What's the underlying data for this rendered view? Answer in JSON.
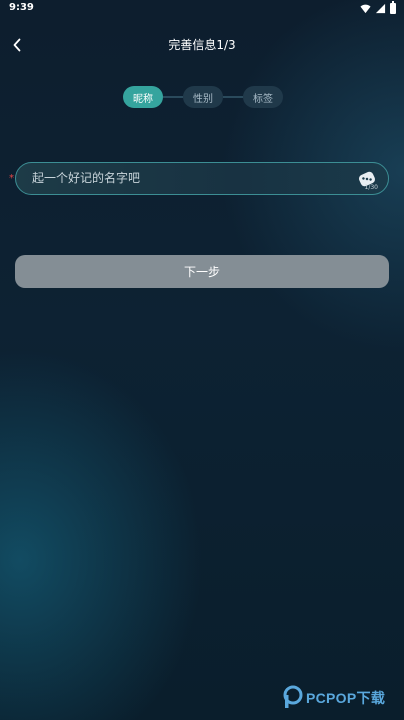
{
  "status_bar": {
    "time": "9:39",
    "icons": [
      "wifi-icon",
      "signal-icon",
      "battery-icon"
    ]
  },
  "header": {
    "back_icon": "chevron-left-icon",
    "title": "完善信息1/3"
  },
  "stepper": {
    "steps": [
      {
        "label": "昵称",
        "active": true
      },
      {
        "label": "性别",
        "active": false
      },
      {
        "label": "标签",
        "active": false
      }
    ]
  },
  "nickname": {
    "required_marker": "*",
    "value": "",
    "placeholder": "起一个好记的名字吧",
    "randomize_icon": "dice-icon",
    "counter": "1/30"
  },
  "next_button": {
    "label": "下一步"
  },
  "watermark": {
    "text": "PCPOP下载"
  },
  "colors": {
    "accent": "#35a49e",
    "inactive_step": "#20394a",
    "button_disabled": "#848e95",
    "required": "#e24747",
    "watermark": "#5aa8dd"
  }
}
